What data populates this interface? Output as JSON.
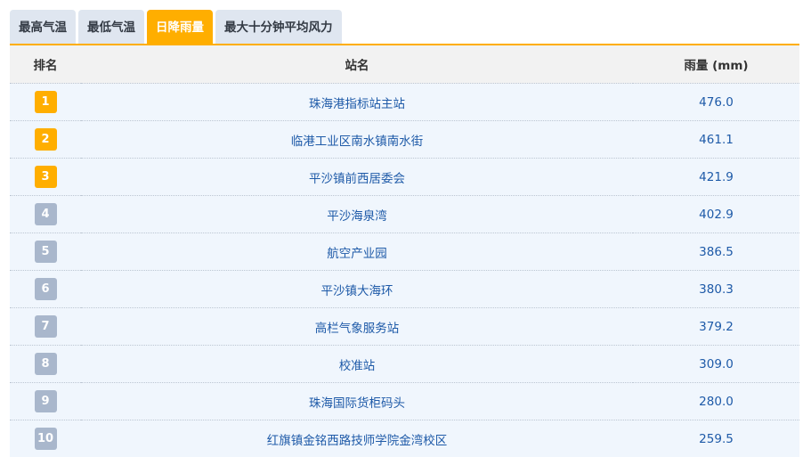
{
  "tabs": [
    {
      "label": "最高气温",
      "active": false
    },
    {
      "label": "最低气温",
      "active": false
    },
    {
      "label": "日降雨量",
      "active": true
    },
    {
      "label": "最大十分钟平均风力",
      "active": false
    }
  ],
  "table": {
    "headers": {
      "rank": "排名",
      "station": "站名",
      "value": "雨量 (mm)"
    },
    "rows": [
      {
        "rank": "1",
        "station": "珠海港指标站主站",
        "value": "476.0"
      },
      {
        "rank": "2",
        "station": "临港工业区南水镇南水街",
        "value": "461.1"
      },
      {
        "rank": "3",
        "station": "平沙镇前西居委会",
        "value": "421.9"
      },
      {
        "rank": "4",
        "station": "平沙海泉湾",
        "value": "402.9"
      },
      {
        "rank": "5",
        "station": "航空产业园",
        "value": "386.5"
      },
      {
        "rank": "6",
        "station": "平沙镇大海环",
        "value": "380.3"
      },
      {
        "rank": "7",
        "station": "高栏气象服务站",
        "value": "379.2"
      },
      {
        "rank": "8",
        "station": "校准站",
        "value": "309.0"
      },
      {
        "rank": "9",
        "station": "珠海国际货柜码头",
        "value": "280.0"
      },
      {
        "rank": "10",
        "station": "红旗镇金铭西路技师学院金湾校区",
        "value": "259.5"
      }
    ]
  },
  "colors": {
    "accent": "#ffae00",
    "tab_inactive_bg": "#dfe6f0",
    "rank_top_badge": "#ffae00",
    "rank_other_badge": "#a9b7cc",
    "link_text": "#1e5aa8",
    "row_bg": "#f0f6fd"
  }
}
